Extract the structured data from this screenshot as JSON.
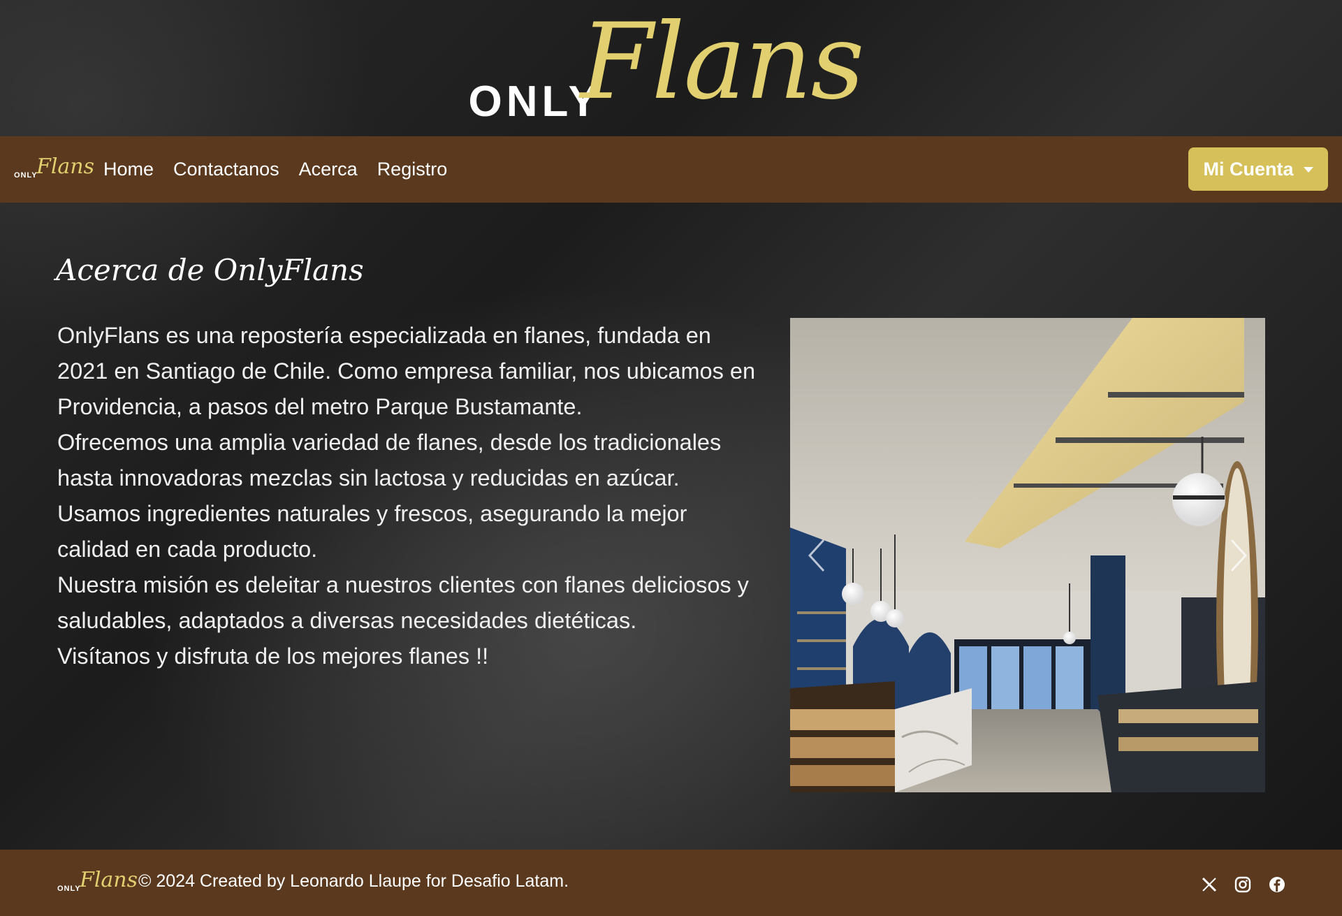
{
  "brand": {
    "only": "ONLY",
    "flans": "Flans"
  },
  "navbar": {
    "logo_only": "ONLY",
    "logo_flans": "Flans",
    "links": [
      "Home",
      "Contactanos",
      "Acerca",
      "Registro"
    ],
    "account_label": "Mi Cuenta"
  },
  "about": {
    "title": "Acerca de OnlyFlans",
    "paragraphs": [
      "OnlyFlans es una repostería especializada en flanes, fundada en 2021 en Santiago de Chile. Como empresa familiar, nos ubicamos en Providencia, a pasos del metro Parque Bustamante.",
      "Ofrecemos una amplia variedad de flanes, desde los tradicionales hasta innovadoras mezclas sin lactosa y reducidas en azúcar.",
      "Usamos ingredientes naturales y frescos, asegurando la mejor calidad en cada producto.",
      "Nuestra misión es deleitar a nuestros clientes con flanes deliciosos y saludables, adaptados a diversas necesidades dietéticas.",
      "Visítanos y disfruta de los mejores flanes !!"
    ]
  },
  "carousel": {
    "prev_icon": "chevron-left-icon",
    "next_icon": "chevron-right-icon"
  },
  "footer": {
    "logo_only": "ONLY",
    "logo_flans": "Flans",
    "text": "© 2024 Created by Leonardo Llaupe for Desafio Latam.",
    "social_icons": [
      "x-icon",
      "instagram-icon",
      "facebook-icon"
    ]
  },
  "colors": {
    "brown": "#5a391e",
    "gold": "#e2cf6f",
    "button_gold": "#d6c05a"
  }
}
